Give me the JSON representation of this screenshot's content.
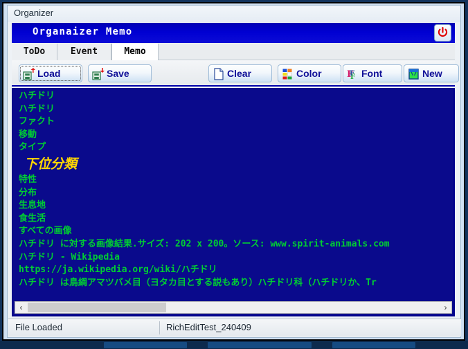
{
  "window": {
    "caption": "Organizer"
  },
  "app": {
    "title": "Organaizer Memo",
    "power_icon": "power-icon"
  },
  "tabs": [
    {
      "label": "ToDo",
      "active": false
    },
    {
      "label": "Event",
      "active": false
    },
    {
      "label": "Memo",
      "active": true
    }
  ],
  "toolbar": {
    "buttons": [
      {
        "label": "Load",
        "icon": "floppy-up-icon",
        "focused": true
      },
      {
        "label": "Save",
        "icon": "floppy-down-icon",
        "focused": false
      },
      {
        "label": "Clear",
        "icon": "page-icon",
        "focused": false
      },
      {
        "label": "Color",
        "icon": "color-grid-icon",
        "focused": false
      },
      {
        "label": "Font",
        "icon": "font-f-icon",
        "focused": false
      },
      {
        "label": "New",
        "icon": "new-doc-icon",
        "focused": false
      }
    ]
  },
  "editor": {
    "background_color": "#0a0a8c",
    "default_text_color": "#00cc33",
    "heading_text_color": "#ffd700",
    "lines": [
      {
        "text": "ハチドリ",
        "style": "normal"
      },
      {
        "text": "ハチドリ",
        "style": "normal"
      },
      {
        "text": "ファクト",
        "style": "normal"
      },
      {
        "text": "移動",
        "style": "normal"
      },
      {
        "text": "タイプ",
        "style": "normal"
      },
      {
        "text": "下位分類",
        "style": "big"
      },
      {
        "text": "特性",
        "style": "normal"
      },
      {
        "text": "分布",
        "style": "normal"
      },
      {
        "text": "生息地",
        "style": "normal"
      },
      {
        "text": "食生活",
        "style": "normal"
      },
      {
        "text": "すべての画像",
        "style": "normal"
      },
      {
        "text": "ハチドリ に対する画像結果.サイズ: 202 x 200。ソース: www.spirit-animals.com",
        "style": "normal"
      },
      {
        "text": "ハチドリ - Wikipedia",
        "style": "normal"
      },
      {
        "text": "https://ja.wikipedia.org/wiki/ハチドリ",
        "style": "normal"
      },
      {
        "text": "ハチドリ は鳥綱アマツバメ目（ヨタカ目とする説もあり）ハチドリ科（ハチドリか、Tr",
        "style": "normal"
      }
    ]
  },
  "hscrollbar": {
    "left_arrow": "‹",
    "right_arrow": "›"
  },
  "statusbar": {
    "message": "File Loaded",
    "filename": "RichEditTest_240409"
  }
}
